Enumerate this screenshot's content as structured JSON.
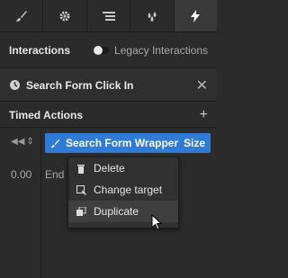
{
  "tabs": [
    {
      "icon": "paintbrush-icon"
    },
    {
      "icon": "gear-icon"
    },
    {
      "icon": "layers-icon"
    },
    {
      "icon": "drops-icon"
    },
    {
      "icon": "lightning-icon",
      "active": true
    }
  ],
  "interactions": {
    "title": "Interactions",
    "toggle_label": "Legacy Interactions"
  },
  "interaction": {
    "name": "Search Form Click In"
  },
  "timed_actions": {
    "title": "Timed Actions"
  },
  "action": {
    "target": "Search Form Wrapper",
    "type": "Size"
  },
  "timeline": {
    "time": "0.00",
    "end_label": "End"
  },
  "context_menu": {
    "items": [
      "Delete",
      "Change target",
      "Duplicate"
    ]
  },
  "colors": {
    "accent": "#2f7bd6",
    "panel": "#2b2b2b"
  }
}
